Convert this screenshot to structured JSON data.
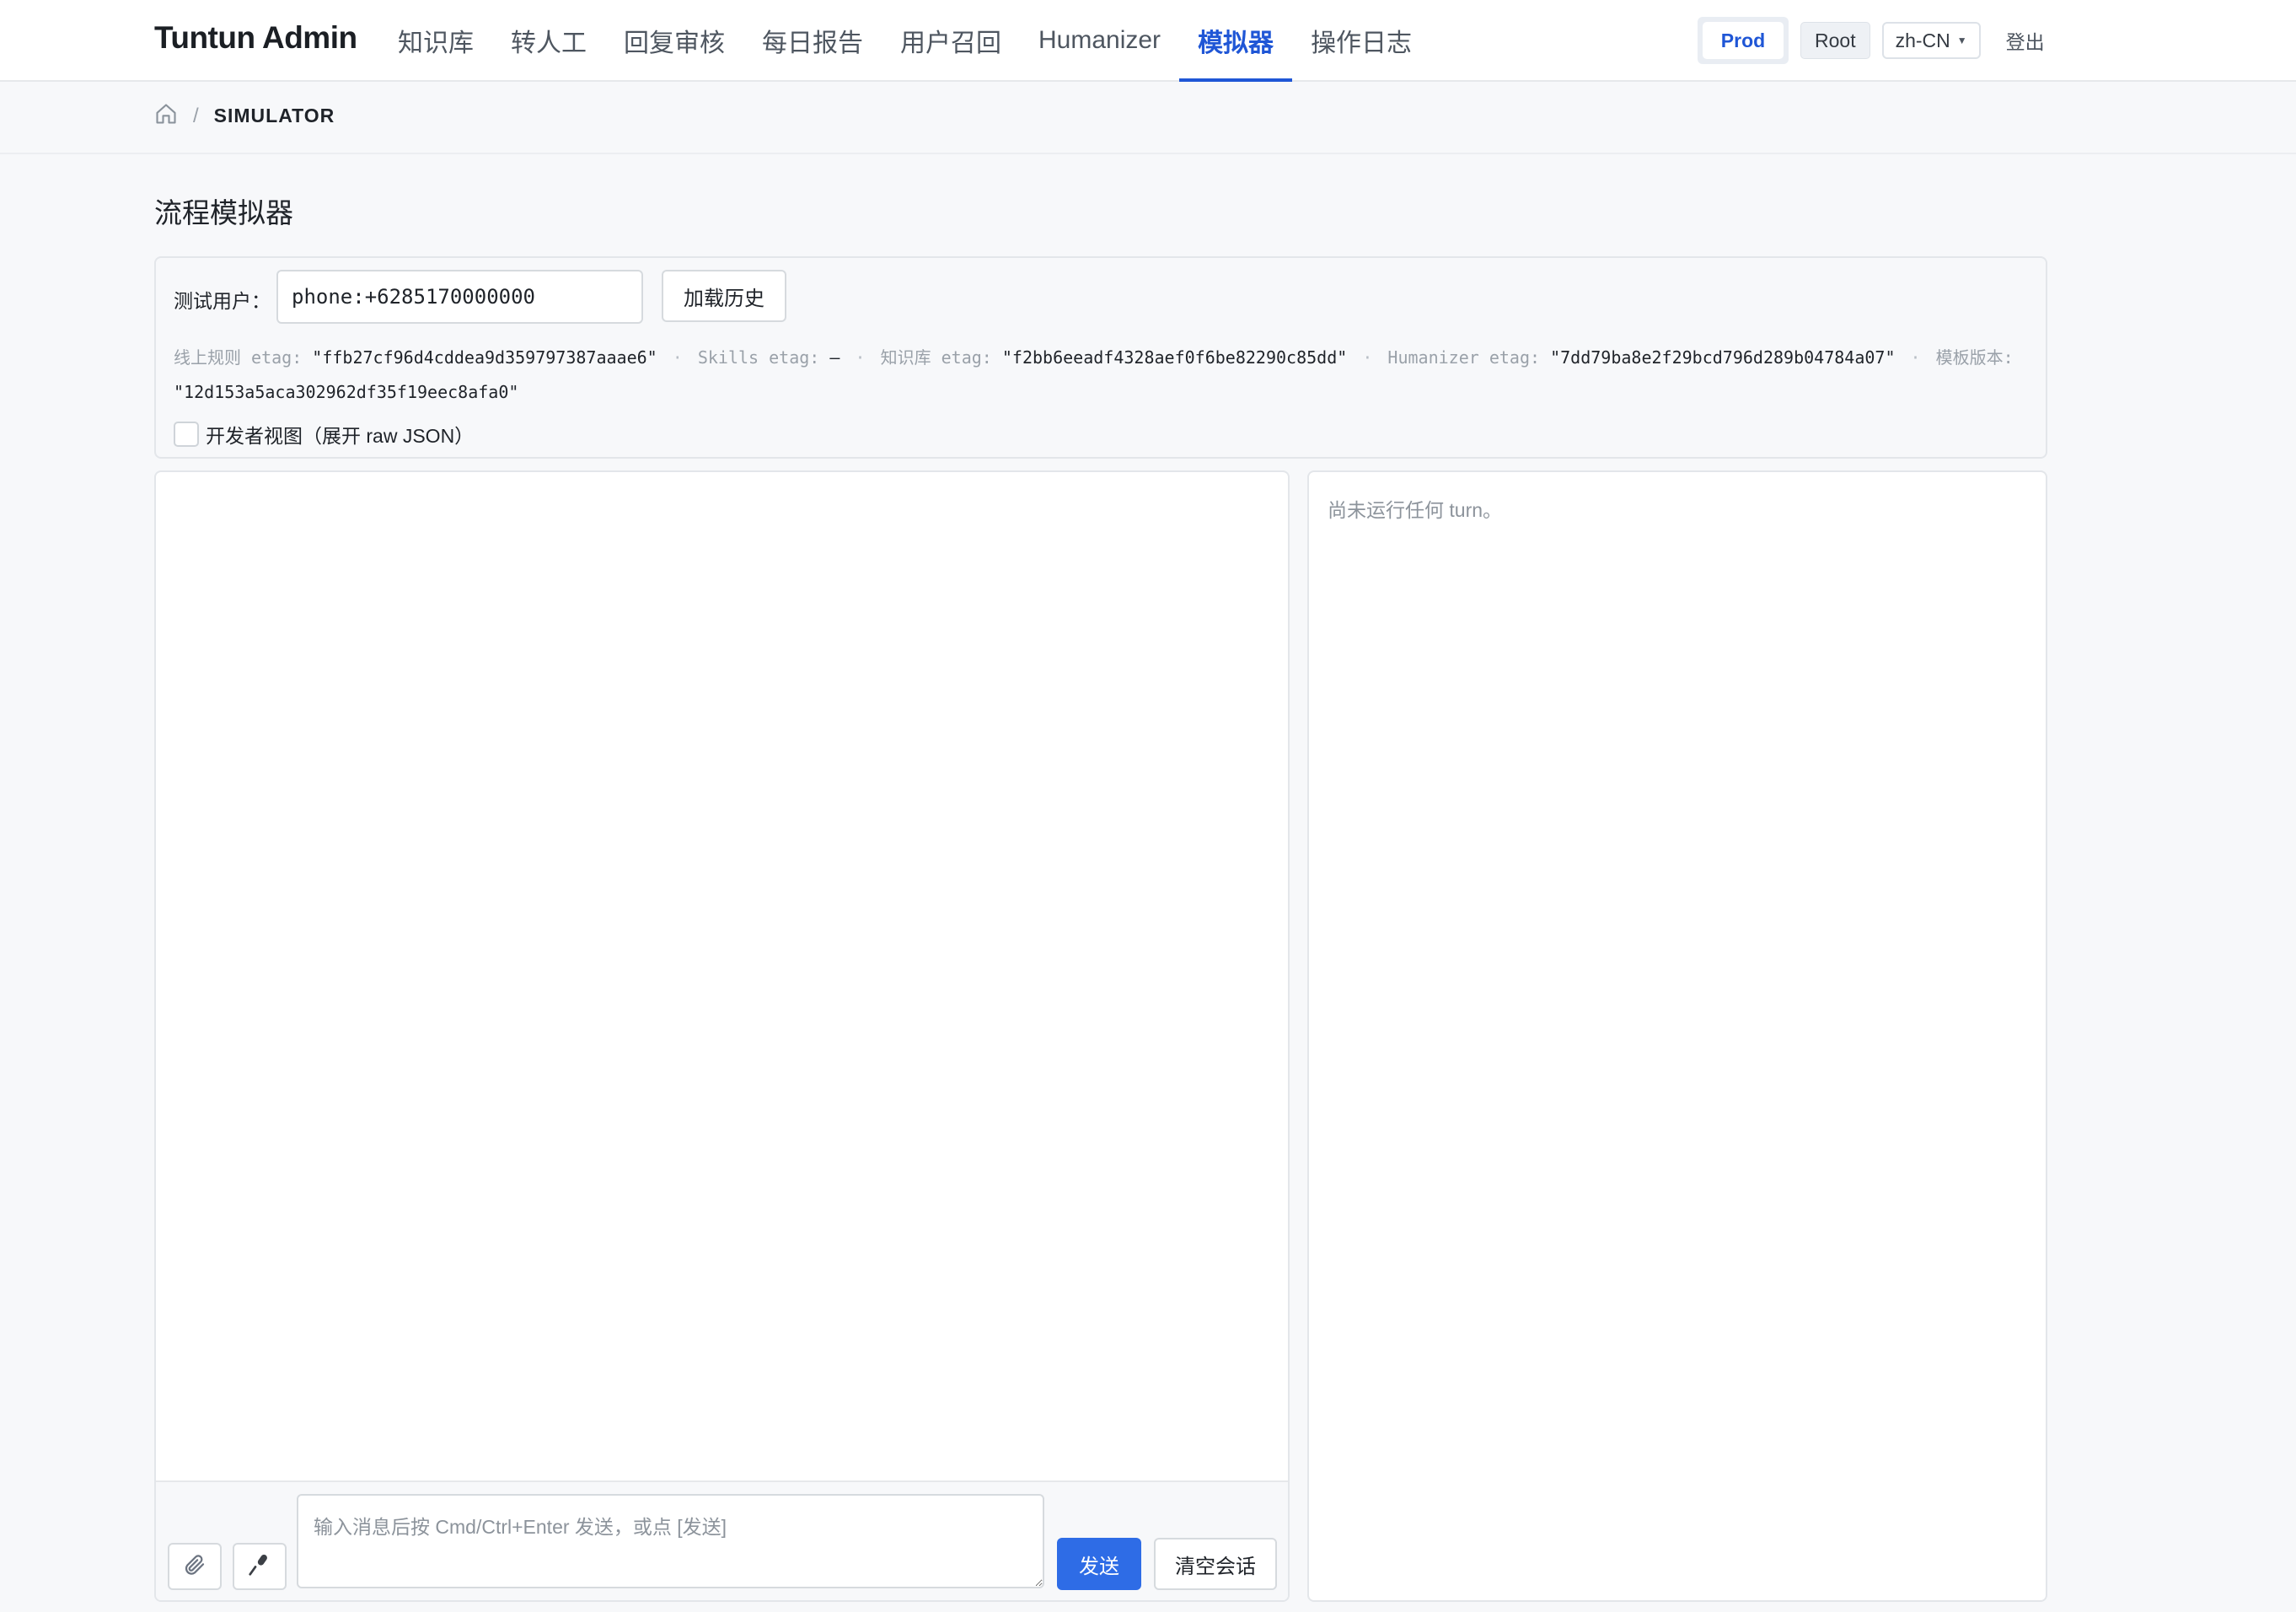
{
  "app": {
    "title": "Tuntun Admin"
  },
  "nav": {
    "items": [
      {
        "label": "知识库",
        "active": false
      },
      {
        "label": "转人工",
        "active": false
      },
      {
        "label": "回复审核",
        "active": false
      },
      {
        "label": "每日报告",
        "active": false
      },
      {
        "label": "用户召回",
        "active": false
      },
      {
        "label": "Humanizer",
        "active": false
      },
      {
        "label": "模拟器",
        "active": true
      },
      {
        "label": "操作日志",
        "active": false
      }
    ]
  },
  "header": {
    "env": "Prod",
    "role": "Root",
    "language": "zh-CN",
    "logout": "登出"
  },
  "breadcrumb": {
    "home_icon": "home-icon",
    "current": "SIMULATOR"
  },
  "page": {
    "title": "流程模拟器"
  },
  "config": {
    "test_user_label": "测试用户：",
    "test_user_value": "phone:+6285170000000",
    "load_history_button": "加载历史",
    "meta": {
      "rules_label": "线上规则 etag:",
      "rules_value": "\"ffb27cf96d4cddea9d359797387aaae6\"",
      "skills_label": "Skills etag:",
      "skills_value": "—",
      "kb_label": "知识库 etag:",
      "kb_value": "\"f2bb6eeadf4328aef0f6be82290c85dd\"",
      "humanizer_label": "Humanizer etag:",
      "humanizer_value": "\"7dd79ba8e2f29bcd796d289b04784a07\"",
      "template_label": "模板版本:",
      "template_value": "\"12d153a5aca302962df35f19eec8afa0\""
    },
    "dev_view_label": "开发者视图（展开 raw JSON）",
    "dev_view_checked": false
  },
  "composer": {
    "attach_icon": "paperclip-icon",
    "mic_icon": "microphone-icon",
    "placeholder": "输入消息后按 Cmd/Ctrl+Enter 发送，或点 [发送]",
    "send_button": "发送",
    "clear_button": "清空会话"
  },
  "trace": {
    "empty_text": "尚未运行任何 turn。"
  },
  "colors": {
    "accent": "#1f56d6",
    "primary_button": "#2e6ce6"
  }
}
